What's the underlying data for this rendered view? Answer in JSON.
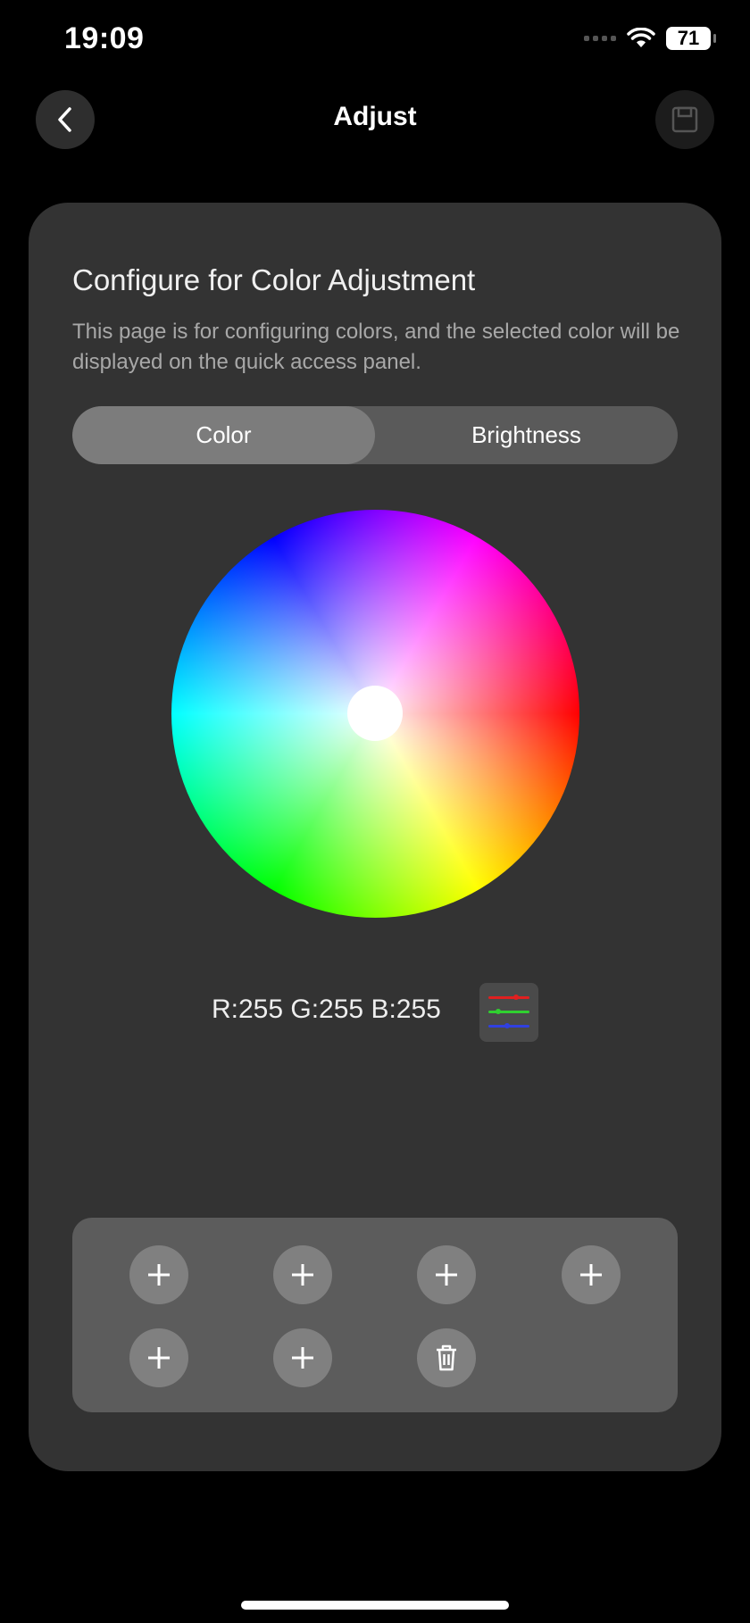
{
  "status": {
    "time": "19:09",
    "battery": "71"
  },
  "nav": {
    "title": "Adjust"
  },
  "card": {
    "title": "Configure for Color Adjustment",
    "description": "This page is for configuring colors, and the selected color will be displayed on the quick access panel."
  },
  "tabs": [
    {
      "label": "Color",
      "active": true
    },
    {
      "label": "Brightness",
      "active": false
    }
  ],
  "color": {
    "readout": "R:255 G:255 B:255",
    "selected_hex": "#ffffff"
  },
  "presets": {
    "add_slots": 6,
    "icons": [
      "plus-icon",
      "trash-icon"
    ]
  },
  "colors": {
    "background": "#000000",
    "card": "#333333",
    "segment_active": "#7c7c7c",
    "preset_panel": "#5c5c5c"
  }
}
